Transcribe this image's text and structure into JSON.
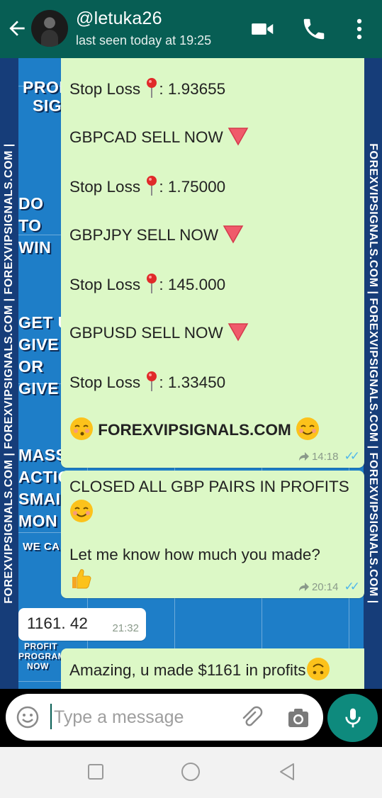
{
  "header": {
    "contact_name": "@letuka26",
    "status": "last seen today at 19:25"
  },
  "wallpaper": {
    "edge_text": "FOREXVIPSIGNALS.COM | FOREXVIPSIGNALS.COM | FOREXVIPSIGNALS.COM |",
    "promo_lines": [
      "PROF",
      "SIG",
      "DO",
      "TO",
      "WIN",
      "GET U",
      "GIVE",
      "OR",
      "GIVE",
      "MASS",
      "ACTIO",
      "SMAI",
      "MON",
      "WE CA"
    ],
    "footer_promo": [
      "PROFIT",
      "PROGRAM",
      "NOW"
    ]
  },
  "messages": {
    "signals": {
      "lines": [
        "Stop Loss",
        ": 1.93655",
        "GBPCAD SELL NOW",
        "Stop Loss",
        ": 1.75000",
        "GBPJPY SELL NOW",
        "Stop Loss",
        ": 145.000",
        "GBPUSD SELL NOW",
        "Stop Loss",
        ": 1.33450",
        "FOREXVIPSIGNALS.COM"
      ],
      "time": "14:18"
    },
    "closed": {
      "line1": "CLOSED ALL GBP PAIRS IN PROFITS",
      "line2": "Let me know how much you made?",
      "time": "20:14"
    },
    "reply": {
      "text": "1161. 42",
      "time": "21:32"
    },
    "amazing": {
      "text": "Amazing, u made $1161 in profits"
    }
  },
  "input": {
    "placeholder": "Type a message"
  },
  "icons": [
    "back-arrow-icon",
    "video-call-icon",
    "phone-icon",
    "more-vert-icon",
    "pin-icon",
    "red-down-triangle-icon",
    "kiss-face-icon",
    "smiling-face-icon",
    "thumbs-up-icon",
    "forwarded-icon",
    "double-check-icon",
    "emoji-icon",
    "attach-icon",
    "camera-icon",
    "mic-icon",
    "square-nav-icon",
    "circle-nav-icon",
    "triangle-nav-icon"
  ],
  "colors": {
    "header": "#075e54",
    "outgoing_bubble": "#dcf8c6",
    "incoming_bubble": "#ffffff",
    "mic_button": "#0e8a7d",
    "read_ticks": "#4fb6ec",
    "wallpaper": "#1e7ec8"
  }
}
